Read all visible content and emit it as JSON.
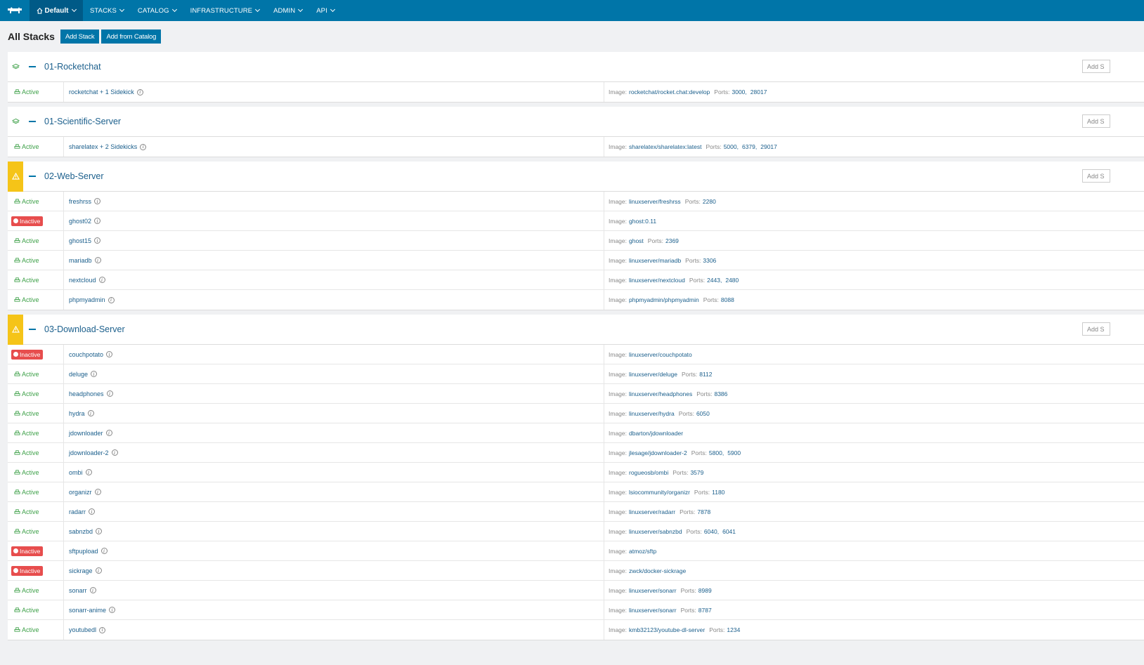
{
  "nav": {
    "environment": "Default",
    "items": [
      "STACKS",
      "CATALOG",
      "INFRASTRUCTURE",
      "ADMIN",
      "API"
    ]
  },
  "header": {
    "title": "All Stacks",
    "add_stack": "Add Stack",
    "add_from_catalog": "Add from Catalog"
  },
  "labels": {
    "image": "Image:",
    "ports": "Ports:",
    "add_service": "Add S"
  },
  "colors": {
    "brand": "#0075a8",
    "active": "#3fa14a",
    "inactive": "#e74d4d",
    "warning": "#f5c418"
  },
  "stacks": [
    {
      "name": "01-Rocketchat",
      "icon": "layers-icon",
      "services": [
        {
          "state": "Active",
          "name": "rocketchat + 1 Sidekick",
          "image": "rocketchat/rocket.chat:develop",
          "ports": [
            "3000",
            "28017"
          ]
        }
      ]
    },
    {
      "name": "01-Scientific-Server",
      "icon": "layers-icon",
      "services": [
        {
          "state": "Active",
          "name": "sharelatex + 2 Sidekicks",
          "image": "sharelatex/sharelatex:latest",
          "ports": [
            "5000",
            "6379",
            "29017"
          ]
        }
      ]
    },
    {
      "name": "02-Web-Server",
      "icon": "warning-icon",
      "services": [
        {
          "state": "Active",
          "name": "freshrss",
          "image": "linuxserver/freshrss",
          "ports": [
            "2280"
          ]
        },
        {
          "state": "Inactive",
          "name": "ghost02",
          "image": "ghost:0.11",
          "ports": []
        },
        {
          "state": "Active",
          "name": "ghost15",
          "image": "ghost",
          "ports": [
            "2369"
          ]
        },
        {
          "state": "Active",
          "name": "mariadb",
          "image": "linuxserver/mariadb",
          "ports": [
            "3306"
          ]
        },
        {
          "state": "Active",
          "name": "nextcloud",
          "image": "linuxserver/nextcloud",
          "ports": [
            "2443",
            "2480"
          ]
        },
        {
          "state": "Active",
          "name": "phpmyadmin",
          "image": "phpmyadmin/phpmyadmin",
          "ports": [
            "8088"
          ]
        }
      ]
    },
    {
      "name": "03-Download-Server",
      "icon": "warning-icon",
      "services": [
        {
          "state": "Inactive",
          "name": "couchpotato",
          "image": "linuxserver/couchpotato",
          "ports": []
        },
        {
          "state": "Active",
          "name": "deluge",
          "image": "linuxserver/deluge",
          "ports": [
            "8112"
          ]
        },
        {
          "state": "Active",
          "name": "headphones",
          "image": "linuxserver/headphones",
          "ports": [
            "8386"
          ]
        },
        {
          "state": "Active",
          "name": "hydra",
          "image": "linuxserver/hydra",
          "ports": [
            "6050"
          ]
        },
        {
          "state": "Active",
          "name": "jdownloader",
          "image": "dbarton/jdownloader",
          "ports": []
        },
        {
          "state": "Active",
          "name": "jdownloader-2",
          "image": "jlesage/jdownloader-2",
          "ports": [
            "5800",
            "5900"
          ]
        },
        {
          "state": "Active",
          "name": "ombi",
          "image": "rogueosb/ombi",
          "ports": [
            "3579"
          ]
        },
        {
          "state": "Active",
          "name": "organizr",
          "image": "lsiocommunity/organizr",
          "ports": [
            "1180"
          ]
        },
        {
          "state": "Active",
          "name": "radarr",
          "image": "linuxserver/radarr",
          "ports": [
            "7878"
          ]
        },
        {
          "state": "Active",
          "name": "sabnzbd",
          "image": "linuxserver/sabnzbd",
          "ports": [
            "6040",
            "6041"
          ]
        },
        {
          "state": "Inactive",
          "name": "sftpupload",
          "image": "atmoz/sftp",
          "ports": []
        },
        {
          "state": "Inactive",
          "name": "sickrage",
          "image": "zwck/docker-sickrage",
          "ports": []
        },
        {
          "state": "Active",
          "name": "sonarr",
          "image": "linuxserver/sonarr",
          "ports": [
            "8989"
          ]
        },
        {
          "state": "Active",
          "name": "sonarr-anime",
          "image": "linuxserver/sonarr",
          "ports": [
            "8787"
          ]
        },
        {
          "state": "Active",
          "name": "youtubedl",
          "image": "kmb32123/youtube-dl-server",
          "ports": [
            "1234"
          ]
        }
      ]
    }
  ]
}
